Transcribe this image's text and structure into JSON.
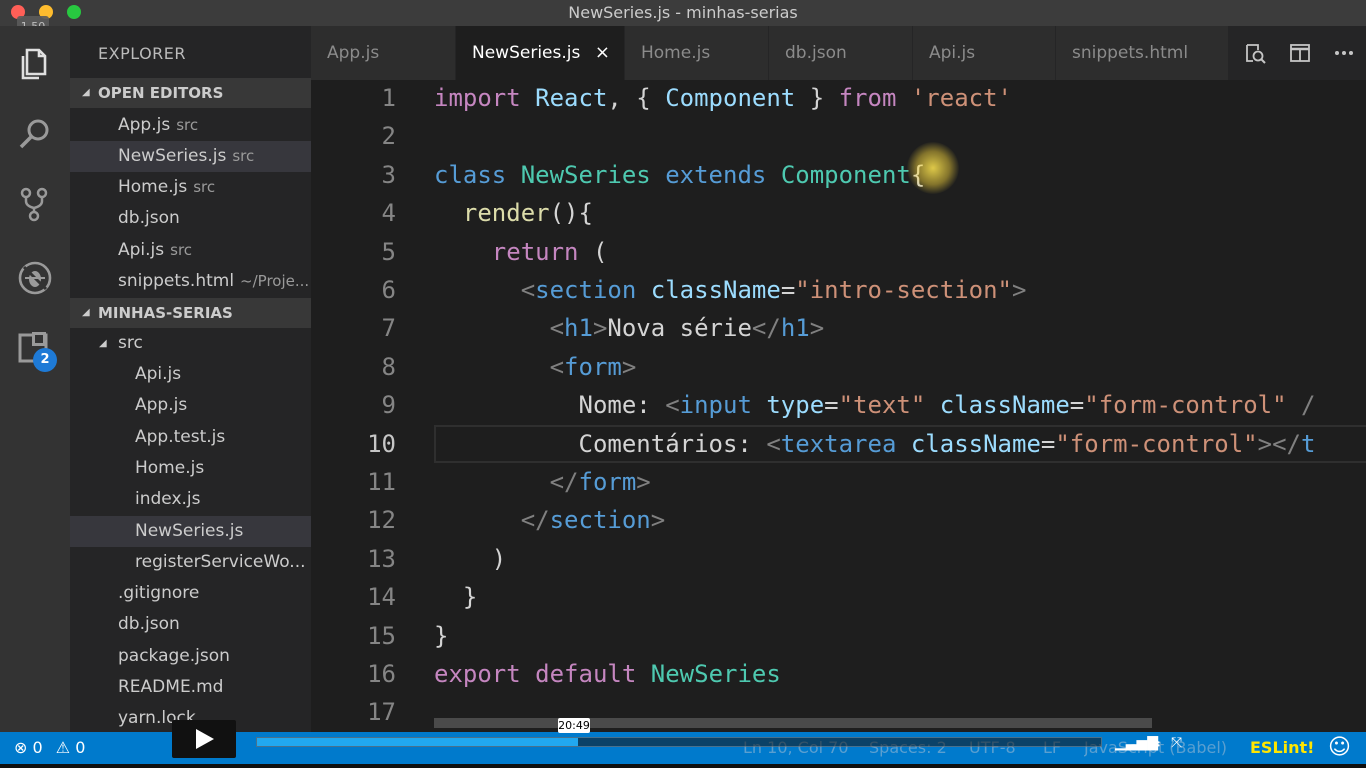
{
  "window": {
    "title": "NewSeries.js - minhas-serias",
    "playback_speed": "1.50"
  },
  "activity_bar": {
    "items": [
      {
        "icon": "files-icon"
      },
      {
        "icon": "search-icon"
      },
      {
        "icon": "source-control-icon"
      },
      {
        "icon": "debug-icon"
      },
      {
        "icon": "extensions-icon"
      }
    ],
    "extensions_badge": "2"
  },
  "sidebar": {
    "title": "EXPLORER",
    "open_editors_label": "OPEN EDITORS",
    "open_editors": [
      {
        "name": "App.js",
        "hint": "src"
      },
      {
        "name": "NewSeries.js",
        "hint": "src",
        "selected": true
      },
      {
        "name": "Home.js",
        "hint": "src"
      },
      {
        "name": "db.json",
        "hint": ""
      },
      {
        "name": "Api.js",
        "hint": "src"
      },
      {
        "name": "snippets.html",
        "hint": "~/Proje..."
      }
    ],
    "project_label": "MINHAS-SERIAS",
    "tree": {
      "folder": "src",
      "src_files": [
        "Api.js",
        "App.js",
        "App.test.js",
        "Home.js",
        "index.js",
        "NewSeries.js",
        "registerServiceWo..."
      ],
      "root_files": [
        ".gitignore",
        "db.json",
        "package.json",
        "README.md",
        "yarn.lock"
      ]
    }
  },
  "tabs": [
    {
      "label": "App.js"
    },
    {
      "label": "NewSeries.js",
      "active": true,
      "close": "×"
    },
    {
      "label": "Home.js"
    },
    {
      "label": "db.json"
    },
    {
      "label": "Api.js"
    },
    {
      "label": "snippets.html"
    }
  ],
  "editor": {
    "current_line": 10,
    "line_numbers": [
      "1",
      "2",
      "3",
      "4",
      "5",
      "6",
      "7",
      "8",
      "9",
      "10",
      "11",
      "12",
      "13",
      "14",
      "15",
      "16",
      "17"
    ],
    "lines": [
      [
        [
          "kw",
          "import"
        ],
        [
          "txt",
          " "
        ],
        [
          "var",
          "React"
        ],
        [
          "txt",
          ", { "
        ],
        [
          "var",
          "Component"
        ],
        [
          "txt",
          " } "
        ],
        [
          "kw",
          "from"
        ],
        [
          "txt",
          " "
        ],
        [
          "str",
          "'react'"
        ]
      ],
      [],
      [
        [
          "kwb",
          "class"
        ],
        [
          "txt",
          " "
        ],
        [
          "cls",
          "NewSeries"
        ],
        [
          "txt",
          " "
        ],
        [
          "kwb",
          "extends"
        ],
        [
          "txt",
          " "
        ],
        [
          "cls",
          "Component"
        ],
        [
          "txt",
          "{"
        ]
      ],
      [
        [
          "txt",
          "  "
        ],
        [
          "fn",
          "render"
        ],
        [
          "txt",
          "(){"
        ]
      ],
      [
        [
          "txt",
          "    "
        ],
        [
          "kw",
          "return"
        ],
        [
          "txt",
          " ("
        ]
      ],
      [
        [
          "txt",
          "      "
        ],
        [
          "tagp",
          "<"
        ],
        [
          "tag",
          "section"
        ],
        [
          "txt",
          " "
        ],
        [
          "attr",
          "className"
        ],
        [
          "txt",
          "="
        ],
        [
          "str",
          "\"intro-section\""
        ],
        [
          "tagp",
          ">"
        ]
      ],
      [
        [
          "txt",
          "        "
        ],
        [
          "tagp",
          "<"
        ],
        [
          "tag",
          "h1"
        ],
        [
          "tagp",
          ">"
        ],
        [
          "txt",
          "Nova série"
        ],
        [
          "tagp",
          "</"
        ],
        [
          "tag",
          "h1"
        ],
        [
          "tagp",
          ">"
        ]
      ],
      [
        [
          "txt",
          "        "
        ],
        [
          "tagp",
          "<"
        ],
        [
          "tag",
          "form"
        ],
        [
          "tagp",
          ">"
        ]
      ],
      [
        [
          "txt",
          "          Nome: "
        ],
        [
          "tagp",
          "<"
        ],
        [
          "tag",
          "input"
        ],
        [
          "txt",
          " "
        ],
        [
          "attr",
          "type"
        ],
        [
          "txt",
          "="
        ],
        [
          "str",
          "\"text\""
        ],
        [
          "txt",
          " "
        ],
        [
          "attr",
          "className"
        ],
        [
          "txt",
          "="
        ],
        [
          "str",
          "\"form-control\""
        ],
        [
          "txt",
          " "
        ],
        [
          "tagp",
          "/"
        ]
      ],
      [
        [
          "txt",
          "          Comentários: "
        ],
        [
          "tagp",
          "<"
        ],
        [
          "tag",
          "textarea"
        ],
        [
          "txt",
          " "
        ],
        [
          "attr",
          "className"
        ],
        [
          "txt",
          "="
        ],
        [
          "str",
          "\"form-control\""
        ],
        [
          "tagp",
          "></"
        ],
        [
          "tag",
          "t"
        ]
      ],
      [
        [
          "txt",
          "        "
        ],
        [
          "tagp",
          "</"
        ],
        [
          "tag",
          "form"
        ],
        [
          "tagp",
          ">"
        ]
      ],
      [
        [
          "txt",
          "      "
        ],
        [
          "tagp",
          "</"
        ],
        [
          "tag",
          "section"
        ],
        [
          "tagp",
          ">"
        ]
      ],
      [
        [
          "txt",
          "    )"
        ]
      ],
      [
        [
          "txt",
          "  }"
        ]
      ],
      [
        [
          "txt",
          "}"
        ]
      ],
      [
        [
          "kw",
          "export"
        ],
        [
          "txt",
          " "
        ],
        [
          "kw",
          "default"
        ],
        [
          "txt",
          " "
        ],
        [
          "cls",
          "NewSeries"
        ]
      ],
      []
    ]
  },
  "statusbar": {
    "errors": "0",
    "warnings": "0",
    "position": "Ln 10, Col 70",
    "spaces": "Spaces: 2",
    "encoding": "UTF-8",
    "eol": "LF",
    "language": "JavaScript (Babel)",
    "eslint": "ESLint!",
    "smiley": "☺"
  },
  "video": {
    "time": "20:49",
    "progress": 0.38
  }
}
